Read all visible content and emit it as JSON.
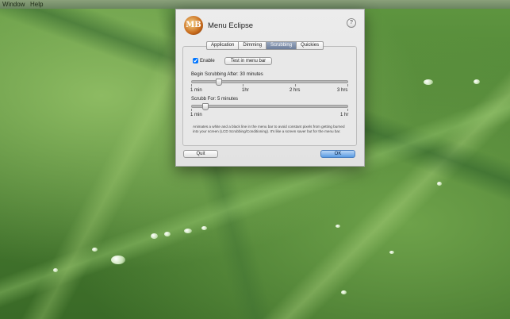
{
  "menubar": {
    "items": [
      "Window",
      "Help"
    ]
  },
  "dialog": {
    "title": "Menu Eclipse",
    "logo_text": "MB",
    "help_label": "?",
    "tabs": [
      {
        "label": "Application",
        "active": false
      },
      {
        "label": "Dimming",
        "active": false
      },
      {
        "label": "Scrubbing",
        "active": true
      },
      {
        "label": "Quickies",
        "active": false
      }
    ],
    "enable": {
      "label": "Enable",
      "checked": true
    },
    "test_button": "Test in menu bar",
    "begin": {
      "label": "Begin Scrubbing After:",
      "value": "30 minutes",
      "tick_labels": [
        "1 min",
        "1hr",
        "2 hrs",
        "3 hrs"
      ],
      "slider_fraction": 0.17
    },
    "scrub": {
      "label": "Scrubb For:",
      "value": "5 minutes",
      "tick_labels": [
        "1 min",
        "1 hr"
      ],
      "slider_fraction": 0.08
    },
    "description": "Animates a white and a black line in the menu bar to avoid constant pixels from getting burned into your screen (LCD Scrubbing/Conditioning). It's like a screen saver but for the menu bar.",
    "quit_button": "Quit",
    "ok_button": "OK"
  },
  "colors": {
    "accent": "#5a9be3",
    "tab_active": "#7a8aa6"
  }
}
